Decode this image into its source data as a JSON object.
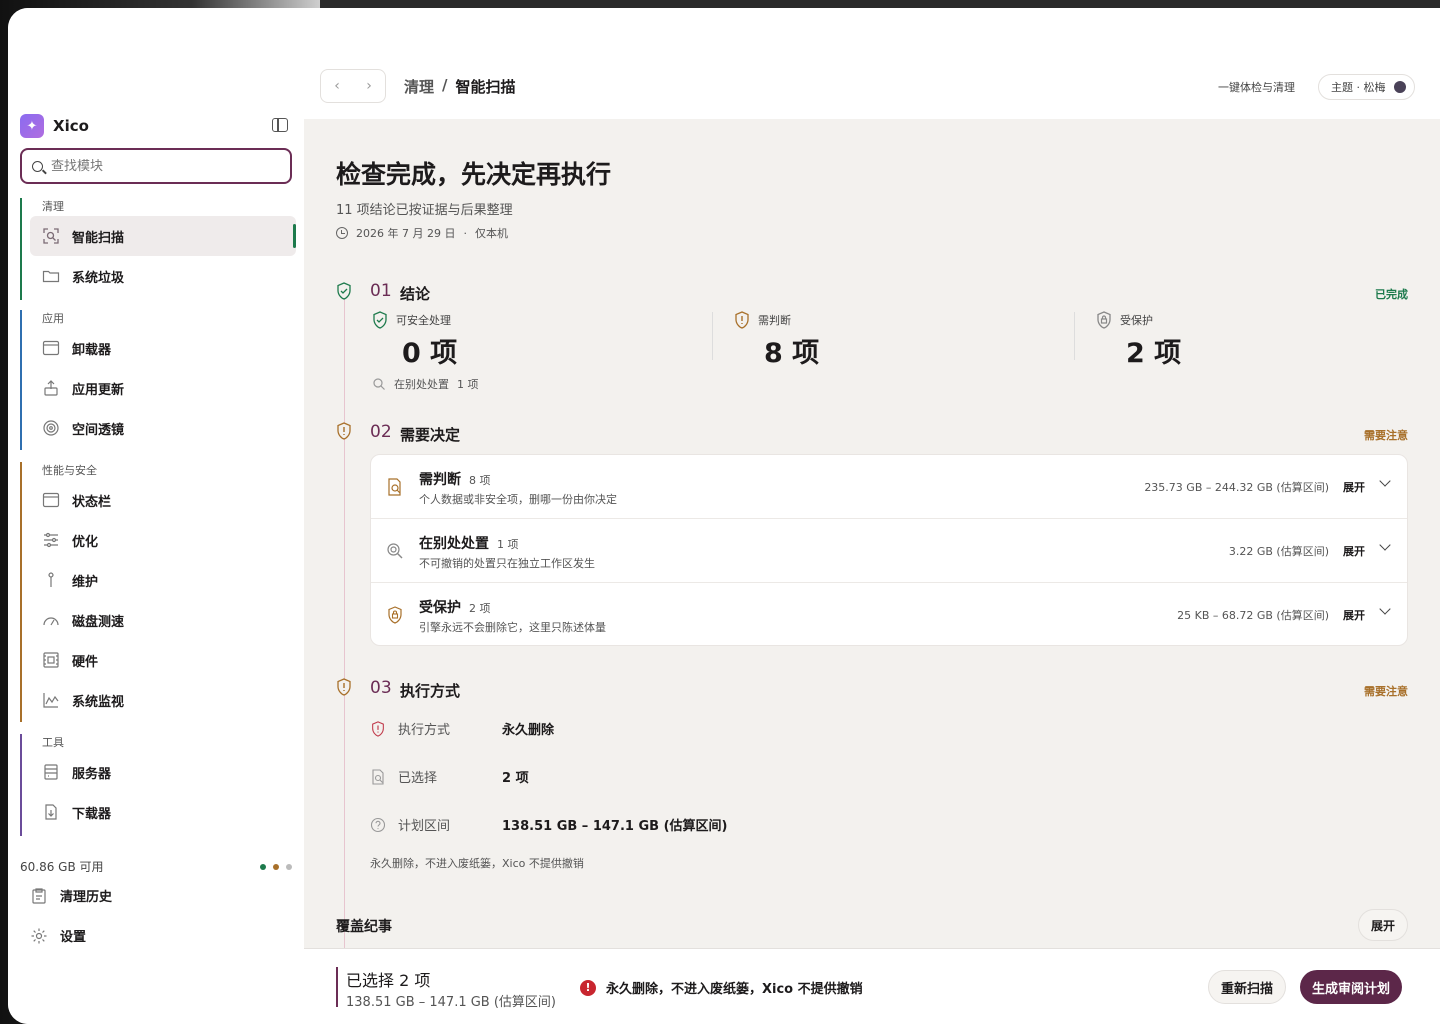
{
  "app": {
    "name": "Xico"
  },
  "search": {
    "placeholder": "查找模块"
  },
  "sidebar": {
    "groups": [
      {
        "label": "清理",
        "color": "#1d7a4c",
        "items": [
          {
            "label": "智能扫描"
          },
          {
            "label": "系统垃圾"
          }
        ]
      },
      {
        "label": "应用",
        "color": "#2f6fb0",
        "items": [
          {
            "label": "卸载器"
          },
          {
            "label": "应用更新"
          },
          {
            "label": "空间透镜"
          }
        ]
      },
      {
        "label": "性能与安全",
        "color": "#a8702a",
        "items": [
          {
            "label": "状态栏"
          },
          {
            "label": "优化"
          },
          {
            "label": "维护"
          },
          {
            "label": "磁盘测速"
          },
          {
            "label": "硬件"
          },
          {
            "label": "系统监视"
          }
        ]
      },
      {
        "label": "工具",
        "color": "#6b4c9a",
        "items": [
          {
            "label": "服务器"
          },
          {
            "label": "下载器"
          }
        ]
      }
    ],
    "storage": "60.86 GB 可用",
    "history": "清理历史",
    "settings": "设置"
  },
  "topbar": {
    "breadcrumb": {
      "parent": "清理",
      "sep": "/",
      "current": "智能扫描"
    },
    "quick_link": "一键体检与清理",
    "theme": "主题 · 松梅"
  },
  "header": {
    "title": "检查完成，先决定再执行",
    "subtitle": "11 项结论已按证据与后果整理",
    "date": "2026 年 7 月 29 日",
    "dot": "·",
    "scope": "仅本机"
  },
  "steps": {
    "s1": {
      "num": "01",
      "title": "结论",
      "status": "已完成",
      "status_color": "#1d7a4c"
    },
    "s2": {
      "num": "02",
      "title": "需要决定",
      "status": "需要注意",
      "status_color": "#a8702a"
    },
    "s3": {
      "num": "03",
      "title": "执行方式",
      "status": "需要注意",
      "status_color": "#a8702a"
    }
  },
  "stats": {
    "safe": {
      "label": "可安全处理",
      "value": "0 项"
    },
    "judge": {
      "label": "需判断",
      "value": "8 项"
    },
    "protected": {
      "label": "受保护",
      "value": "2 项"
    },
    "elsewhere": {
      "label": "在别处处置",
      "count": "1 项"
    }
  },
  "decisions": [
    {
      "title": "需判断",
      "count": "8 项",
      "desc": "个人数据或非安全项，删哪一份由你决定",
      "size": "235.73 GB – 244.32 GB (估算区间)",
      "expand": "展开"
    },
    {
      "title": "在别处处置",
      "count": "1 项",
      "desc": "不可撤销的处置只在独立工作区发生",
      "size": "3.22 GB (估算区间)",
      "expand": "展开"
    },
    {
      "title": "受保护",
      "count": "2 项",
      "desc": "引擎永远不会删除它，这里只陈述体量",
      "size": "25 KB – 68.72 GB (估算区间)",
      "expand": "展开"
    }
  ],
  "execution": {
    "method": {
      "key": "执行方式",
      "value": "永久删除"
    },
    "selected": {
      "key": "已选择",
      "value": "2 项"
    },
    "range": {
      "key": "计划区间",
      "value": "138.51 GB – 147.1 GB (估算区间)"
    },
    "note": "永久删除，不进入废纸篓，Xico 不提供撤销"
  },
  "coverage": {
    "title": "覆盖纪事",
    "button": "展开"
  },
  "footer": {
    "selected_title": "已选择 2 项",
    "selected_range": "138.51 GB – 147.1 GB (估算区间)",
    "warning": "永久删除，不进入废纸篓，Xico 不提供撤销",
    "warning_icon": "!",
    "rescan": "重新扫描",
    "plan": "生成审阅计划"
  }
}
